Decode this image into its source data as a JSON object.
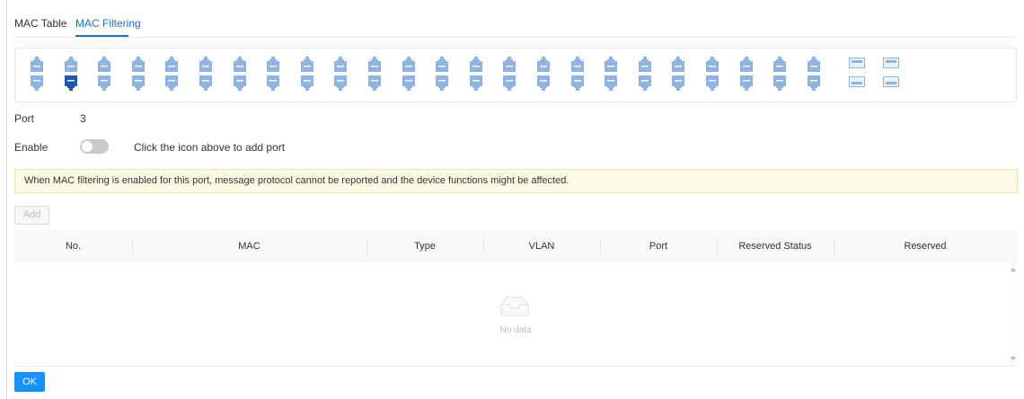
{
  "tabs": [
    {
      "label": "MAC Table",
      "active": false
    },
    {
      "label": "MAC Filtering",
      "active": true
    }
  ],
  "ports": {
    "rj45_count": 24,
    "selected_port": 3,
    "sfp_count": 4,
    "color_default": "#8fb4e3",
    "color_selected": "#1f56b5"
  },
  "form": {
    "port_label": "Port",
    "port_value": "3",
    "enable_label": "Enable",
    "enable_state": false,
    "enable_hint": "Click the icon above to add port"
  },
  "notice": {
    "text": "When MAC filtering is enabled for this port, message protocol cannot be reported and the device functions might be affected."
  },
  "toolbar": {
    "add_label": "Add"
  },
  "table": {
    "columns": [
      "No.",
      "MAC",
      "Type",
      "VLAN",
      "Port",
      "Reserved Status",
      "Reserved"
    ],
    "rows": [],
    "empty_text": "No data"
  },
  "footer": {
    "ok_label": "OK"
  },
  "colors": {
    "accent": "#1e6fd9",
    "primary_button": "#1890ff",
    "notice_bg": "#fffbe6"
  }
}
